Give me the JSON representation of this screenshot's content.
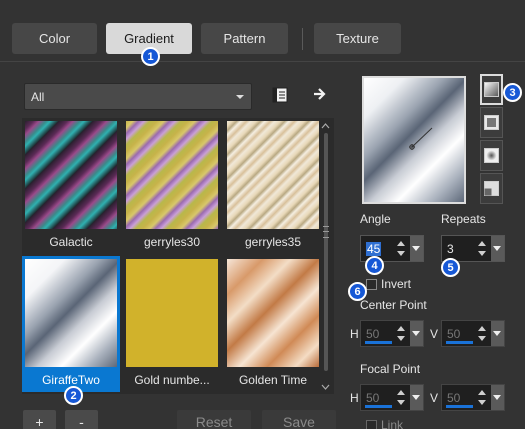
{
  "tabs": [
    {
      "label": "Color"
    },
    {
      "label": "Gradient"
    },
    {
      "label": "Pattern"
    },
    {
      "label": "Texture"
    }
  ],
  "category_select": {
    "value": "All"
  },
  "gradients": [
    {
      "name": "Galactic"
    },
    {
      "name": "gerryles30"
    },
    {
      "name": "gerryles35"
    },
    {
      "name": "GiraffeTwo"
    },
    {
      "name": "Gold numbe..."
    },
    {
      "name": "Golden Time"
    }
  ],
  "selected_gradient": "GiraffeTwo",
  "buttons": {
    "add": "+",
    "remove": "-",
    "reset": "Reset",
    "save": "Save"
  },
  "angle": {
    "label": "Angle",
    "value": "45"
  },
  "repeats": {
    "label": "Repeats",
    "value": "3"
  },
  "invert": {
    "label": "Invert",
    "checked": false
  },
  "center_point": {
    "label": "Center Point",
    "h_label": "H",
    "h_value": "50",
    "v_label": "V",
    "v_value": "50"
  },
  "focal_point": {
    "label": "Focal Point",
    "h_label": "H",
    "h_value": "50",
    "v_label": "V",
    "v_value": "50"
  },
  "link": {
    "label": "Link"
  },
  "badges": [
    "1",
    "2",
    "3",
    "4",
    "5",
    "6"
  ],
  "colors": {
    "accent": "#0a78d1",
    "badge": "#1658d6",
    "background": "#333333"
  }
}
